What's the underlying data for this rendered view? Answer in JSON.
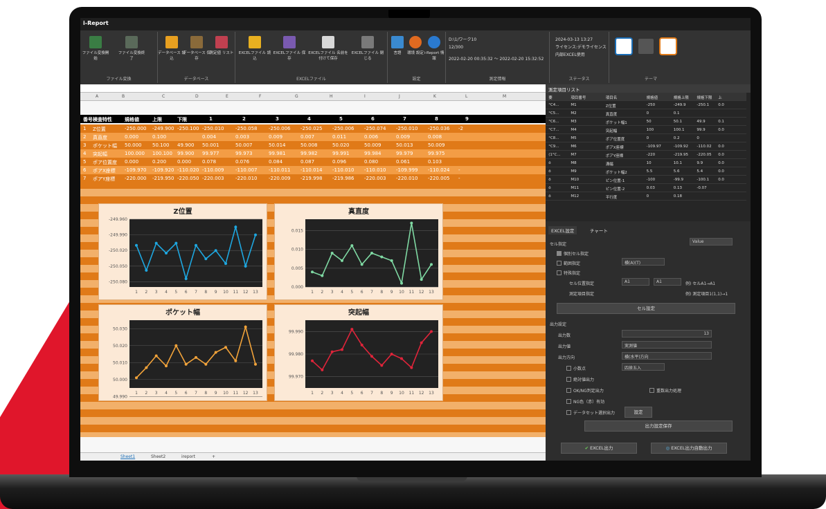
{
  "app": {
    "title": "i-Report"
  },
  "ribbon": {
    "buttons": [
      "ファイル変換開始",
      "ファイル変換終了",
      "データベース 読込",
      "データベース 保存",
      "測定値 リスト",
      "EXCELファイル 読込",
      "EXCELファイル 保存",
      "EXCELファイル 名前を付けて保存",
      "EXCELファイル 閉じる",
      "言語",
      "環境 設定",
      "i-Report 情報"
    ],
    "groups": [
      "ファイル変換",
      "データベース",
      "EXCELファイル",
      "設定",
      "測定情報",
      "ステータス",
      "テーマ"
    ],
    "measure_info": [
      "D:\\1/ワーク10",
      "12/300",
      "2022-02-20 00:35:32 ～ 2022-02-20 15:32:52"
    ],
    "status_info": [
      "2024-03-13 13:27",
      "ライセンス:デモライセンス",
      "内部EXCEL使用"
    ]
  },
  "sheet": {
    "columns": [
      "A",
      "B",
      "C",
      "D",
      "E",
      "F",
      "G",
      "H",
      "I",
      "J",
      "K",
      "L",
      "M"
    ],
    "header": [
      "番号",
      "検査特性",
      "規格値",
      "上限",
      "下限",
      "1",
      "2",
      "3",
      "4",
      "5",
      "6",
      "7",
      "8",
      "9"
    ],
    "rows": [
      [
        "1",
        "Z位置",
        "-250.000",
        "-249.900",
        "-250.100",
        "-250.010",
        "-250.058",
        "-250.006",
        "-250.025",
        "-250.006",
        "-250.074",
        "-250.010",
        "-250.036",
        "-2"
      ],
      [
        "2",
        "真直度",
        "0.000",
        "0.100",
        "",
        "0.004",
        "0.003",
        "0.009",
        "0.007",
        "0.011",
        "0.006",
        "0.009",
        "0.008",
        ""
      ],
      [
        "3",
        "ポケット幅",
        "50.000",
        "50.100",
        "49.900",
        "50.001",
        "50.007",
        "50.014",
        "50.008",
        "50.020",
        "50.009",
        "50.013",
        "50.009",
        ""
      ],
      [
        "4",
        "突起幅",
        "100.000",
        "100.100",
        "99.900",
        "99.977",
        "99.973",
        "99.981",
        "99.982",
        "99.991",
        "99.984",
        "99.979",
        "99.975",
        ""
      ],
      [
        "5",
        "ポア位置度",
        "0.000",
        "0.200",
        "0.000",
        "0.078",
        "0.076",
        "0.084",
        "0.087",
        "0.096",
        "0.080",
        "0.061",
        "0.103",
        ""
      ],
      [
        "6",
        "ポアX座標",
        "-109.970",
        "-109.920",
        "-110.020",
        "-110.009",
        "-110.007",
        "-110.011",
        "-110.014",
        "-110.010",
        "-110.010",
        "-109.999",
        "-110.024",
        "-"
      ],
      [
        "7",
        "ポアY座標",
        "-220.000",
        "-219.950",
        "-220.050",
        "-220.003",
        "-220.010",
        "-220.009",
        "-219.998",
        "-219.986",
        "-220.003",
        "-220.010",
        "-220.005",
        "-"
      ]
    ],
    "tabs": [
      "Sheet1",
      "Sheet2",
      "ireport",
      "+"
    ]
  },
  "chart_data": [
    {
      "type": "line",
      "title": "Z位置",
      "x": [
        1,
        2,
        3,
        4,
        5,
        6,
        7,
        8,
        9,
        10,
        11,
        12,
        13
      ],
      "values": [
        -250.01,
        -250.058,
        -250.006,
        -250.025,
        -250.006,
        -250.074,
        -250.01,
        -250.036,
        -250.02,
        -250.045,
        -249.975,
        -250.05,
        -249.99
      ],
      "ylim": [
        -250.09,
        -249.96
      ],
      "yticks": [
        "-249.960",
        "-249.990",
        "-250.020",
        "-250.050",
        "-250.080"
      ],
      "color": "#1ea7e0"
    },
    {
      "type": "line",
      "title": "真直度",
      "x": [
        1,
        2,
        3,
        4,
        5,
        6,
        7,
        8,
        9,
        10,
        11,
        12,
        13
      ],
      "values": [
        0.004,
        0.003,
        0.009,
        0.007,
        0.011,
        0.006,
        0.009,
        0.008,
        0.007,
        0.001,
        0.017,
        0.002,
        0.006
      ],
      "ylim": [
        0,
        0.018
      ],
      "yticks": [
        "0.015",
        "0.010",
        "0.005",
        "0.000"
      ],
      "color": "#7fd9a3"
    },
    {
      "type": "line",
      "title": "ポケット幅",
      "x": [
        1,
        2,
        3,
        4,
        5,
        6,
        7,
        8,
        9,
        10,
        11,
        12,
        13
      ],
      "values": [
        50.001,
        50.007,
        50.014,
        50.008,
        50.02,
        50.009,
        50.013,
        50.009,
        50.016,
        50.019,
        50.011,
        50.031,
        50.009
      ],
      "ylim": [
        49.995,
        50.035
      ],
      "yticks": [
        "50.030",
        "50.020",
        "50.010",
        "50.000",
        "49.990"
      ],
      "color": "#f2a33a"
    },
    {
      "type": "line",
      "title": "突起幅",
      "x": [
        1,
        2,
        3,
        4,
        5,
        6,
        7,
        8,
        9,
        10,
        11,
        12,
        13
      ],
      "values": [
        99.977,
        99.973,
        99.981,
        99.982,
        99.991,
        99.984,
        99.979,
        99.975,
        99.98,
        99.978,
        99.974,
        99.985,
        99.99
      ],
      "ylim": [
        99.965,
        99.995
      ],
      "yticks": [
        "99.990",
        "99.980",
        "99.970"
      ],
      "color": "#e0243a"
    }
  ],
  "panel": {
    "list_title": "測定項目リスト",
    "list_headers": [
      "要",
      "項目番号",
      "項目名",
      "規格値",
      "規格上限",
      "規格下限",
      "上"
    ],
    "list_rows": [
      [
        "°C4...",
        "M1",
        "Z位置",
        "-250",
        "-249.9",
        "-250.1",
        "0.0"
      ],
      [
        "°C5...",
        "M2",
        "真直度",
        "0",
        "0.1",
        "",
        ""
      ],
      [
        "°C6...",
        "M3",
        "ポケット幅1",
        "50",
        "50.1",
        "49.9",
        "0.1"
      ],
      [
        "°C7...",
        "M4",
        "突起幅",
        "100",
        "100.1",
        "99.9",
        "0.0"
      ],
      [
        "°C8...",
        "M5",
        "ポア位置度",
        "0",
        "0.2",
        "0",
        ""
      ],
      [
        "°C9...",
        "M6",
        "ポアX座標",
        "-109.97",
        "-109.92",
        "-110.02",
        "0.0"
      ],
      [
        "(1°C...",
        "M7",
        "ポアY座標",
        "-220",
        "-219.95",
        "-220.05",
        "0.0"
      ],
      [
        "ö",
        "M8",
        "溝幅",
        "10",
        "10.1",
        "9.9",
        "0.0"
      ],
      [
        "ö",
        "M9",
        "ポケット幅2",
        "5.5",
        "5.6",
        "5.4",
        "0.0"
      ],
      [
        "ö",
        "M10",
        "ピン位置-1",
        "-100",
        "-99.9",
        "-100.1",
        "0.0"
      ],
      [
        "ö",
        "M11",
        "ピン位置-2",
        "0.03",
        "0.13",
        "-0.07",
        ""
      ],
      [
        "ö",
        "M12",
        "平行度",
        "0",
        "0.18",
        "",
        ""
      ]
    ],
    "tab_excel": "EXCEL設定",
    "tab_chart": "チャート",
    "cell_spec": "セル指定",
    "value_select": "Value",
    "opt_individual": "個別セル指定",
    "opt_range": "範囲指定",
    "opt_special": "特殊指定",
    "range_hint": "横(A)(T)",
    "cell_pos": "セル位置指定",
    "a1": "A1",
    "a1b": "A1",
    "cell_hint": "例) セルA1→A1",
    "meas_item": "測定項目指定",
    "meas_hint": "例) 測定項目1(1,1)→1",
    "cell_setting_btn": "セル設定",
    "output_setting": "出力設定",
    "out_count_label": "出力数",
    "out_count": "13",
    "out_value_label": "出力値",
    "out_value": "実測値",
    "out_dir_label": "出力方向",
    "out_dir": "横(水平)方向",
    "decimal": "小数点",
    "decimal_select": "四捨五入",
    "abs_output": "絶対値出力",
    "okng_output": "OK/NG判定出力",
    "invert_output": "重数出力処理",
    "ng_color": "NG色（赤）有効",
    "dataset_output": "データセット選択出力",
    "dataset_btn": "設定",
    "save_btn": "出力設定保存",
    "excel_out_btn": "EXCEL出力",
    "excel_auto_btn": "EXCEL出力自動出力"
  }
}
